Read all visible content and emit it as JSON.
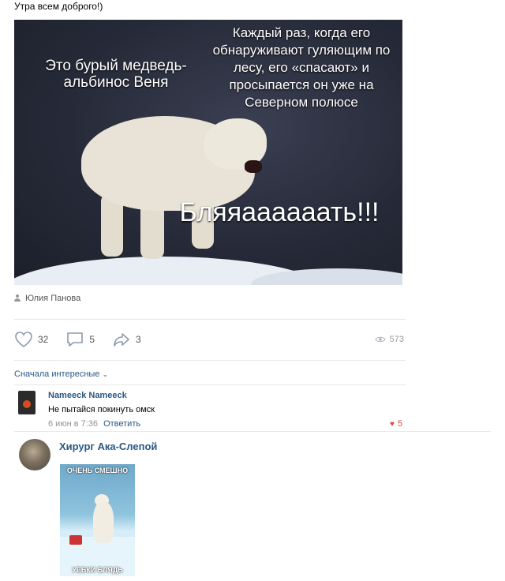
{
  "post": {
    "text": "Утра всем доброго!)",
    "image": {
      "caption_left": "Это бурый медведь-альбинос Веня",
      "caption_right": "Каждый раз, когда его обнаруживают гуляющим по лесу, его «спасают» и просыпается он уже на Северном полюсе",
      "caption_big": "Бляяаааааать!!!"
    },
    "author": "Юлия Панова",
    "likes": "32",
    "comments": "5",
    "shares": "3",
    "views": "573"
  },
  "sort": {
    "label": "Сначала интересные"
  },
  "comments": [
    {
      "name": "Nameeck Nameeck",
      "text": "Не пытайся покинуть омск",
      "date": "6 июн в 7:36",
      "reply": "Ответить",
      "likes": "5"
    },
    {
      "name": "Хирург Ака-Слепой",
      "image_top": "ОЧЕНЬ СМЕШНО",
      "image_bottom": "УЕБКИ БЛЯДЬ"
    }
  ],
  "colors": {
    "link": "#2a5885",
    "like": "#e64646",
    "muted": "#939393"
  },
  "icons": [
    "person-icon",
    "heart-icon",
    "comment-icon",
    "share-icon",
    "eye-icon",
    "chevron-down-icon"
  ]
}
